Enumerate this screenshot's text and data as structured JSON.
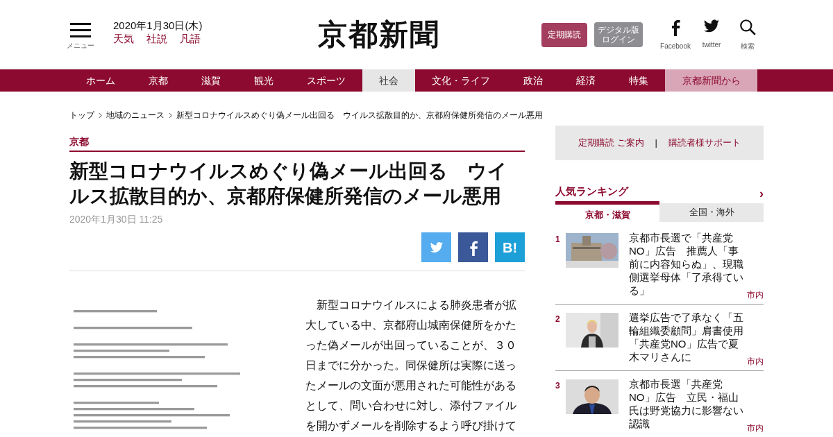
{
  "header": {
    "menu_label": "メニュー",
    "date": "2020年1月30日(木)",
    "quick_links": [
      "天気",
      "社説",
      "凡語"
    ],
    "logo": "京都新聞",
    "subscribe_button": "定期購読",
    "login_button": [
      "デジタル版",
      "ログイン"
    ],
    "icons": [
      {
        "kind": "facebook",
        "label": "Facebook"
      },
      {
        "kind": "twitter",
        "label": "twitter"
      },
      {
        "kind": "search",
        "label": "検索"
      }
    ]
  },
  "nav": [
    {
      "label": "ホーム",
      "selected": false,
      "kind": "section"
    },
    {
      "label": "京都",
      "selected": false,
      "kind": "section"
    },
    {
      "label": "滋賀",
      "selected": false,
      "kind": "section"
    },
    {
      "label": "観光",
      "selected": false,
      "kind": "section"
    },
    {
      "label": "スポーツ",
      "selected": false,
      "kind": "section"
    },
    {
      "label": "社会",
      "selected": true,
      "kind": "section"
    },
    {
      "label": "文化・ライフ",
      "selected": false,
      "kind": "section"
    },
    {
      "label": "政治",
      "selected": false,
      "kind": "section"
    },
    {
      "label": "経済",
      "selected": false,
      "kind": "section"
    },
    {
      "label": "特集",
      "selected": false,
      "kind": "section"
    },
    {
      "label": "京都新聞から",
      "selected": false,
      "kind": "promo"
    }
  ],
  "breadcrumb": [
    "トップ",
    "地域のニュース",
    "新型コロナウイルスめぐり偽メール出回る　ウイルス拡散目的か、京都府保健所発信のメール悪用"
  ],
  "article": {
    "category": "京都",
    "title": "新型コロナウイルスめぐり偽メール出回る　ウイルス拡散目的か、京都府保健所発信のメール悪用",
    "timestamp": "2020年1月30日 11:25",
    "share_buttons": [
      {
        "kind": "twitter"
      },
      {
        "kind": "facebook"
      },
      {
        "kind": "hatena",
        "label": "B!"
      }
    ],
    "body": "　新型コロナウイルスによる肺炎患者が拡大している中、京都府山城南保健所をかたった偽メールが出回っていることが、３０日までに分かった。同保健所は実際に送ったメールの文面が悪用された可能性があるとして、問い合わせに対し、添付ファイルを開かずメールを削除するよう呼び掛けて"
  },
  "sidebar": {
    "links": [
      "定期購読 ご案内",
      "購読者様サポート"
    ],
    "separator": "|",
    "ranking": {
      "title": "人気ランキング",
      "more": "›",
      "tabs": [
        {
          "label": "京都・滋賀",
          "selected": true
        },
        {
          "label": "全国・海外",
          "selected": false
        }
      ],
      "items": [
        {
          "rank": "1",
          "title": "京都市長選で「共産党NO」広告　推薦人「事前に内容知らぬ」、現職側選挙母体「了承得ている」",
          "tag": "市内"
        },
        {
          "rank": "2",
          "title": "選挙広告で了承なく「五輪組織委顧問」肩書使用「共産党NO」広告で夏木マリさんに",
          "tag": "市内"
        },
        {
          "rank": "3",
          "title": "京都市長選「共産党NO」広告　立民・福山氏は野党協力に影響ない認識",
          "tag": "市内"
        }
      ]
    }
  }
}
